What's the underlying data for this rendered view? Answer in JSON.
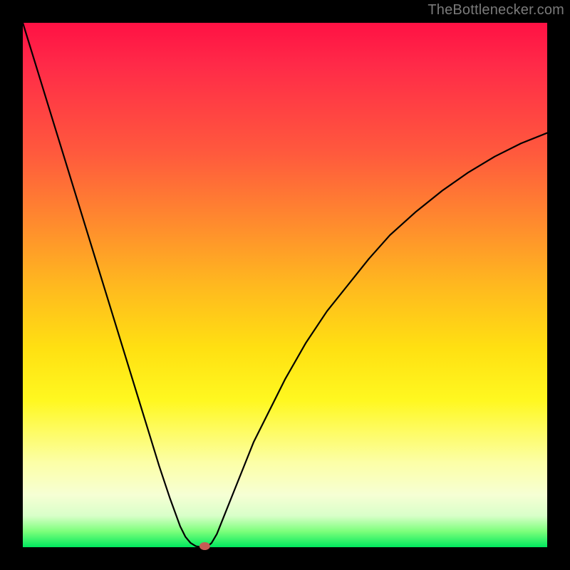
{
  "watermark": {
    "text": "TheBottlenecker.com"
  },
  "chart_data": {
    "type": "line",
    "title": "",
    "xlabel": "",
    "ylabel": "",
    "xlim": [
      0,
      100
    ],
    "ylim": [
      0,
      100
    ],
    "x": [
      0,
      2,
      4,
      6,
      8,
      10,
      12,
      14,
      16,
      18,
      20,
      22,
      24,
      26,
      28,
      30,
      31,
      32,
      33,
      34,
      35,
      36,
      37,
      38,
      40,
      42,
      44,
      47,
      50,
      54,
      58,
      62,
      66,
      70,
      75,
      80,
      85,
      90,
      95,
      100
    ],
    "values": [
      100,
      93.5,
      87,
      80.5,
      74,
      67.5,
      61,
      54.5,
      48,
      41.5,
      35,
      28.5,
      22,
      15.5,
      9.5,
      4,
      2,
      0.8,
      0.2,
      0,
      0,
      0.8,
      2.5,
      5,
      10,
      15,
      20,
      26,
      32,
      39,
      45,
      50,
      55,
      59.5,
      64,
      68,
      71.5,
      74.5,
      77,
      79
    ],
    "marker": {
      "x": 34.7,
      "y": 0.2
    },
    "colors": {
      "gradient_top": "#ff1144",
      "gradient_mid": "#ffe012",
      "gradient_bottom": "#00e85e",
      "curve": "#000000",
      "marker": "#c75c55",
      "frame": "#000000"
    }
  }
}
